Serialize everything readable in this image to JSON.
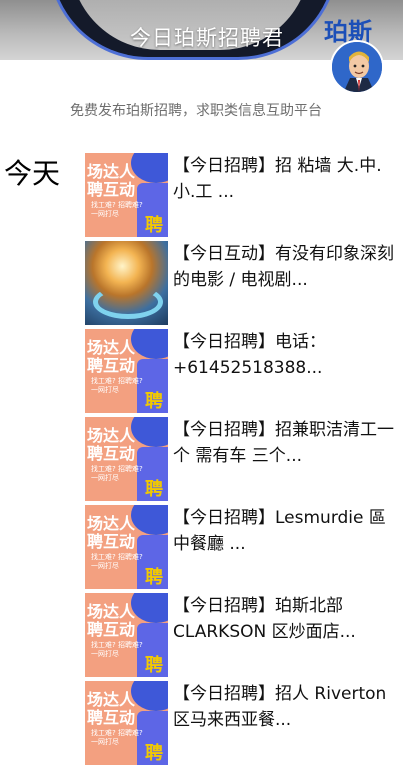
{
  "header": {
    "title": "今日珀斯招聘君"
  },
  "logo": {
    "text": "珀斯"
  },
  "subtitle": "免费发布珀斯招聘，求职类信息互助平台",
  "section_label": "今天",
  "thumbnail_text": {
    "big": "场达人\n聘互动",
    "small": "找工难? 招聘难?\n一网打尽",
    "ping": "聘"
  },
  "articles": [
    {
      "title": "【今日招聘】招 粘墙 大.中.小.工 ...",
      "thumb": "recruit"
    },
    {
      "title": "【今日互动】有没有印象深刻的电影 / 电视剧...",
      "thumb": "art"
    },
    {
      "title": "【今日招聘】电话：+61452518388...",
      "thumb": "recruit"
    },
    {
      "title": "【今日招聘】招兼职洁清工一个 需有车 三个...",
      "thumb": "recruit"
    },
    {
      "title": "【今日招聘】Lesmurdie 區 中餐廳 ...",
      "thumb": "recruit"
    },
    {
      "title": "【今日招聘】珀斯北部 CLARKSON 区炒面店...",
      "thumb": "recruit"
    },
    {
      "title": "【今日招聘】招人 Riverton区马来西亚餐...",
      "thumb": "recruit"
    }
  ]
}
